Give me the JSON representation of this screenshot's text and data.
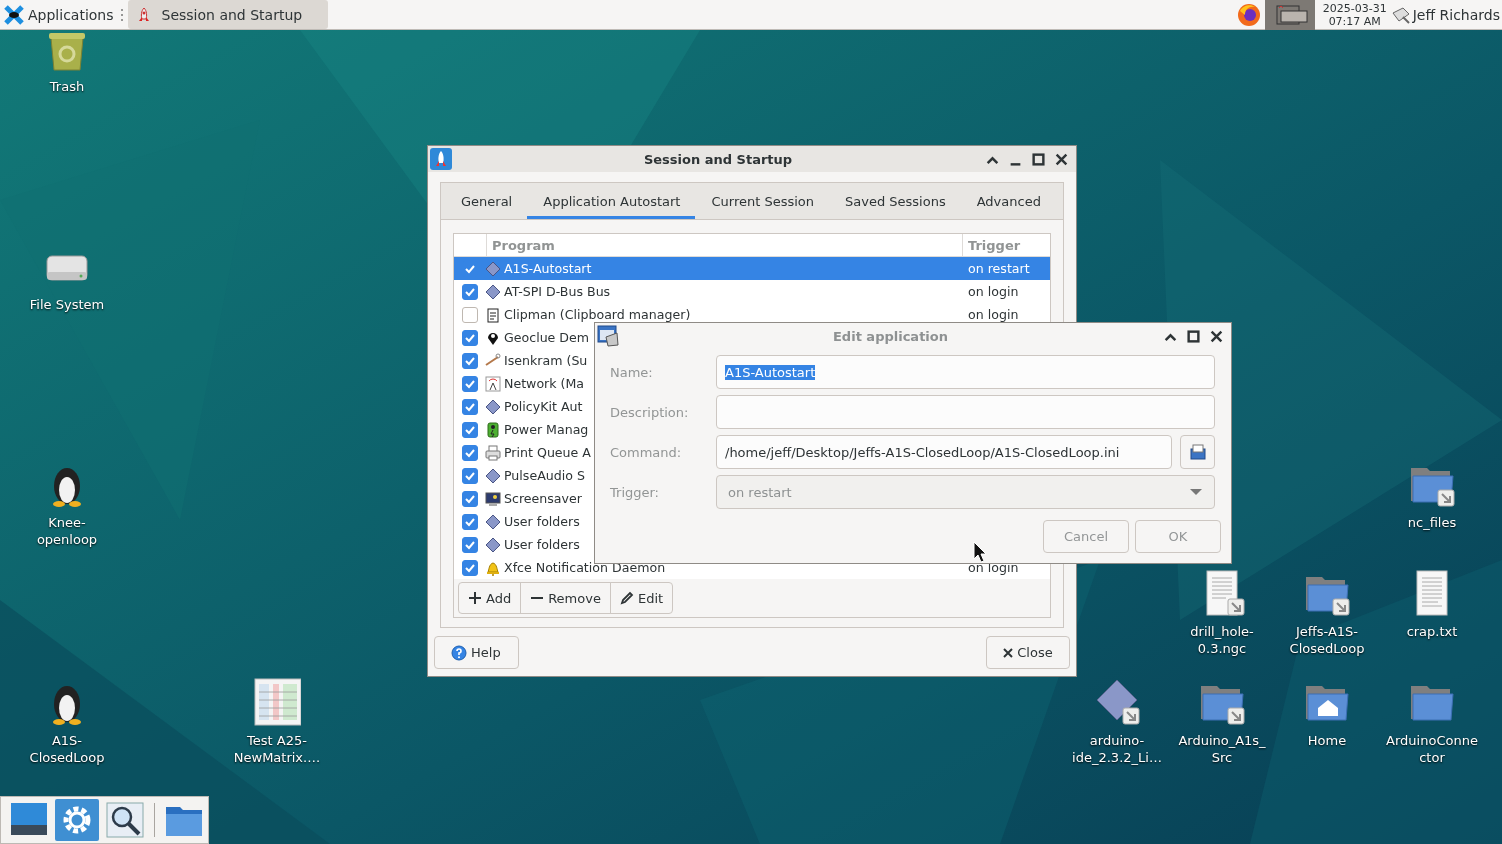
{
  "top_panel": {
    "applications_menu": "Applications",
    "tasks": [
      {
        "title": "Session and Startup",
        "selected": true
      }
    ],
    "clock": {
      "date": "2025-03-31",
      "time": "07:17 AM"
    },
    "user": "Jeff Richards"
  },
  "desktop_icons": [
    {
      "label": "Trash",
      "kind": "trash"
    },
    {
      "label": "File System",
      "kind": "drive"
    },
    {
      "label": "Knee-openloop",
      "kind": "penguin"
    },
    {
      "label": "A1S-ClosedLoop",
      "kind": "penguin"
    },
    {
      "label": "Test A25-NewMatrix.…",
      "kind": "sheet"
    },
    {
      "label": "nc_files",
      "kind": "folder-link"
    },
    {
      "label": "drill_hole-0.3.ngc",
      "kind": "doc-link"
    },
    {
      "label": "Jeffs-A1S-ClosedLoop",
      "kind": "folder-link"
    },
    {
      "label": "crap.txt",
      "kind": "doc"
    },
    {
      "label": "arduino-ide_2.3.2_Li…",
      "kind": "diamond-link"
    },
    {
      "label": "Arduino_A1s_Src",
      "kind": "folder-link"
    },
    {
      "label": "Home",
      "kind": "home"
    },
    {
      "label": "ArduinoConnector",
      "kind": "folder"
    }
  ],
  "session_window": {
    "title": "Session and Startup",
    "focused": true,
    "tabs": [
      {
        "label": "General",
        "selected": false
      },
      {
        "label": "Application Autostart",
        "selected": true
      },
      {
        "label": "Current Session",
        "selected": false
      },
      {
        "label": "Saved Sessions",
        "selected": false
      },
      {
        "label": "Advanced",
        "selected": false
      }
    ],
    "columns": [
      "Program",
      "Trigger"
    ],
    "programs": [
      {
        "name": "A1S-Autostart",
        "trigger": "on restart",
        "checked": true,
        "selected": true,
        "kind": "diamond"
      },
      {
        "name": "AT-SPI D-Bus Bus",
        "trigger": "on login",
        "checked": true,
        "selected": false,
        "kind": "diamond"
      },
      {
        "name": "Clipman (Clipboard manager)",
        "trigger": "on login",
        "checked": false,
        "selected": false,
        "kind": "clipboard"
      },
      {
        "name": "Geoclue Dem",
        "checked": true,
        "selected": false,
        "kind": "pin"
      },
      {
        "name": "Isenkram (Su",
        "checked": true,
        "selected": false,
        "kind": "chain"
      },
      {
        "name": "Network (Ma",
        "checked": true,
        "selected": false,
        "kind": "antenna"
      },
      {
        "name": "PolicyKit Aut",
        "checked": true,
        "selected": false,
        "kind": "diamond"
      },
      {
        "name": "Power Manag",
        "checked": true,
        "selected": false,
        "kind": "battery"
      },
      {
        "name": "Print Queue A",
        "checked": true,
        "selected": false,
        "kind": "printer"
      },
      {
        "name": "PulseAudio S",
        "checked": true,
        "selected": false,
        "kind": "diamond"
      },
      {
        "name": "Screensaver",
        "checked": true,
        "selected": false,
        "kind": "screen"
      },
      {
        "name": "User folders",
        "checked": true,
        "selected": false,
        "kind": "diamond"
      },
      {
        "name": "User folders",
        "checked": true,
        "selected": false,
        "kind": "diamond"
      },
      {
        "name": "Xfce Notification Daemon",
        "trigger": "on login",
        "checked": true,
        "selected": false,
        "kind": "bell"
      }
    ],
    "toolbar": [
      {
        "label": "Add",
        "kind": "add"
      },
      {
        "label": "Remove",
        "kind": "remove"
      },
      {
        "label": "Edit",
        "kind": "edit"
      }
    ],
    "help_button": "Help",
    "close_button": "Close"
  },
  "edit_dialog": {
    "title": "Edit application",
    "focused": false,
    "fields": [
      {
        "label": "Name:",
        "kind": "text",
        "value": "A1S-Autostart",
        "highlighted": true
      },
      {
        "label": "Description:",
        "kind": "text"
      },
      {
        "label": "Command:",
        "kind": "file",
        "value": "/home/jeff/Desktop/Jeffs-A1S-ClosedLoop/A1S-ClosedLoop.ini"
      },
      {
        "label": "Trigger:",
        "kind": "dropdown",
        "value": "on restart"
      }
    ],
    "buttons": [
      "Cancel",
      "OK"
    ]
  }
}
